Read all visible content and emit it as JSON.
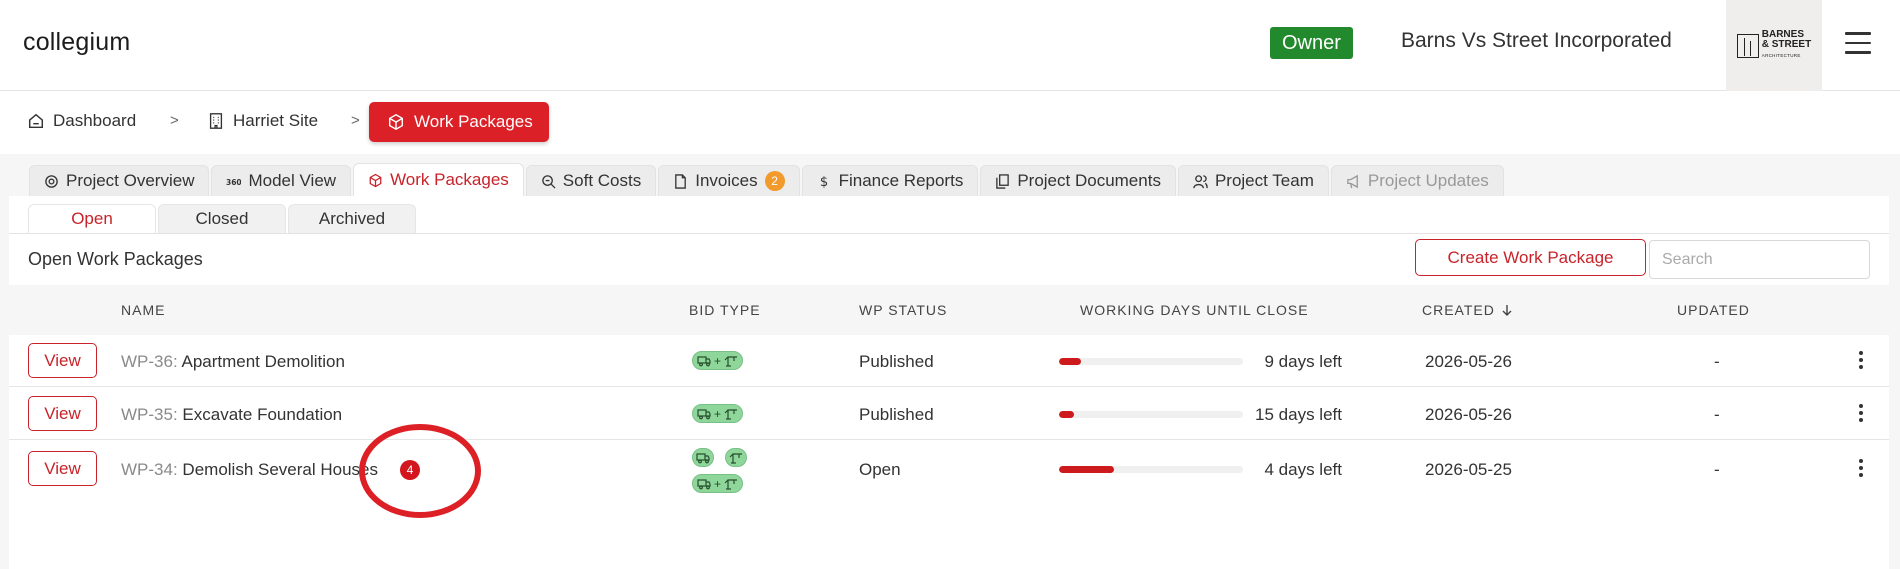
{
  "header": {
    "brand": "collegium",
    "role_badge": "Owner",
    "company": "Barns Vs Street Incorporated",
    "logo_text_1": "BARNES",
    "logo_text_2": "& STREET",
    "logo_text_3": "ARCHITECTURE"
  },
  "breadcrumb": {
    "items": [
      {
        "label": "Dashboard",
        "icon": "home-icon"
      },
      {
        "label": "Harriet Site",
        "icon": "building-icon"
      },
      {
        "label": "Work Packages",
        "icon": "cube-icon"
      }
    ],
    "separator": ">"
  },
  "module_tabs": [
    {
      "label": "Project Overview",
      "icon": "overview-icon"
    },
    {
      "label": "Model View",
      "icon": "360-icon"
    },
    {
      "label": "Work Packages",
      "icon": "cube-icon",
      "active": true
    },
    {
      "label": "Soft Costs",
      "icon": "magnifier-icon"
    },
    {
      "label": "Invoices",
      "icon": "document-icon",
      "count": "2"
    },
    {
      "label": "Finance Reports",
      "icon": "dollar-icon"
    },
    {
      "label": "Project Documents",
      "icon": "documents-icon"
    },
    {
      "label": "Project Team",
      "icon": "team-icon"
    },
    {
      "label": "Project Updates",
      "icon": "megaphone-icon",
      "disabled": true
    }
  ],
  "sub_tabs": [
    {
      "label": "Open",
      "active": true
    },
    {
      "label": "Closed"
    },
    {
      "label": "Archived"
    }
  ],
  "section": {
    "title": "Open Work Packages",
    "create_label": "Create Work Package",
    "search_placeholder": "Search"
  },
  "table": {
    "headers": {
      "name": "NAME",
      "bid_type": "BID TYPE",
      "wp_status": "WP STATUS",
      "working_days": "WORKING DAYS UNTIL CLOSE",
      "created": "CREATED",
      "updated": "UPDATED"
    },
    "rows": [
      {
        "view": "View",
        "code": "WP-36:",
        "name": "Apartment Demolition",
        "bid": "+",
        "status": "Published",
        "progress": 0.12,
        "days_left": "9 days left",
        "created": "2026-05-26",
        "updated": "-"
      },
      {
        "view": "View",
        "code": "WP-35:",
        "name": "Excavate Foundation",
        "bid": "+",
        "status": "Published",
        "progress": 0.08,
        "days_left": "15 days left",
        "created": "2026-05-26",
        "updated": "-"
      },
      {
        "view": "View",
        "code": "WP-34:",
        "name": "Demolish Several Houses",
        "bid": "+",
        "status": "Open",
        "progress": 0.3,
        "days_left": "4 days left",
        "created": "2026-05-25",
        "updated": "-",
        "notification_count": "4"
      }
    ]
  },
  "colors": {
    "accent": "#c8232a",
    "owner_badge": "#22892d",
    "progress": "#cc1a1d",
    "bid_pill": "#8fd69b",
    "invoice_count": "#f39a2c"
  }
}
